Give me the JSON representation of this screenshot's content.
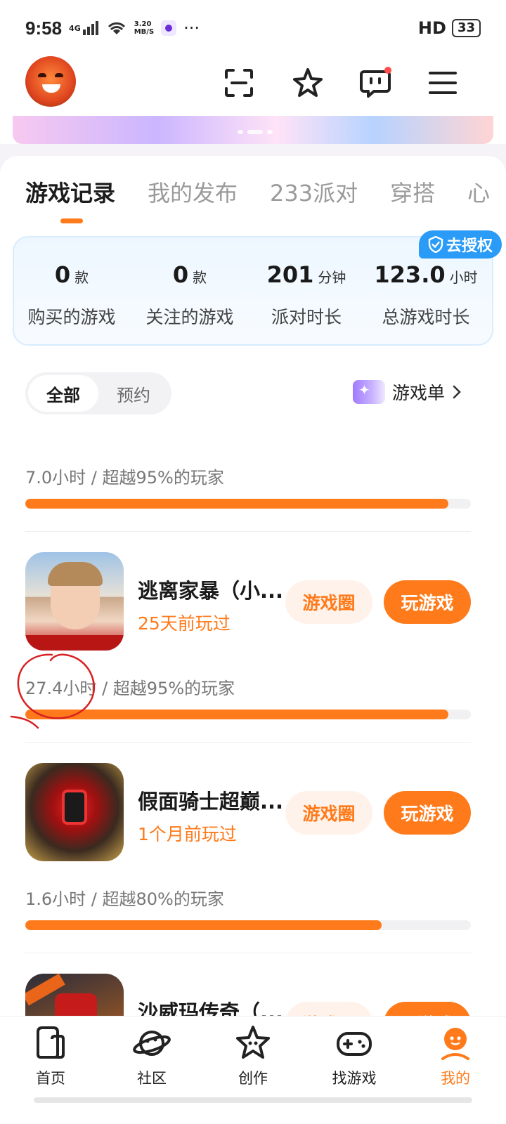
{
  "status_bar": {
    "time": "9:58",
    "network": "4G",
    "speed_value": "3.20",
    "speed_unit": "MB/S",
    "more": "···",
    "hd": "HD",
    "battery": "33"
  },
  "tabs": [
    "游戏记录",
    "我的发布",
    "233派对",
    "穿搭",
    "心"
  ],
  "auth_badge": "去授权",
  "stats": [
    {
      "value": "0",
      "unit": "款",
      "label": "购买的游戏"
    },
    {
      "value": "0",
      "unit": "款",
      "label": "关注的游戏"
    },
    {
      "value": "201",
      "unit": "分钟",
      "label": "派对时长"
    },
    {
      "value": "123.0",
      "unit": "小时",
      "label": "总游戏时长"
    }
  ],
  "filter": {
    "all": "全部",
    "reserve": "预约"
  },
  "game_list_link": "游戏单",
  "games": [
    {
      "stat": "7.0小时 / 超越95%的玩家",
      "progress": 0.95
    },
    {
      "title": "逃离家暴（小...",
      "last_played": "25天前玩过",
      "circle_btn": "游戏圈",
      "play_btn": "玩游戏",
      "stat": "27.4小时 / 超越95%的玩家",
      "progress": 0.95
    },
    {
      "title": "假面骑士超巅...",
      "last_played": "1个月前玩过",
      "circle_btn": "游戏圈",
      "play_btn": "玩游戏",
      "stat": "1.6小时 / 超越80%的玩家",
      "progress": 0.8
    },
    {
      "title": "沙威玛传奇（...",
      "circle_btn": "游戏圈",
      "play_btn": "玩游戏"
    }
  ],
  "bottom_nav": [
    {
      "label": "首页",
      "icon": "home-icon"
    },
    {
      "label": "社区",
      "icon": "community-planet-icon"
    },
    {
      "label": "创作",
      "icon": "create-star-icon"
    },
    {
      "label": "找游戏",
      "icon": "gamepad-icon"
    },
    {
      "label": "我的",
      "icon": "profile-icon",
      "active": true
    }
  ],
  "colors": {
    "accent": "#ff7a1a",
    "auth_blue": "#2a9bf7"
  }
}
